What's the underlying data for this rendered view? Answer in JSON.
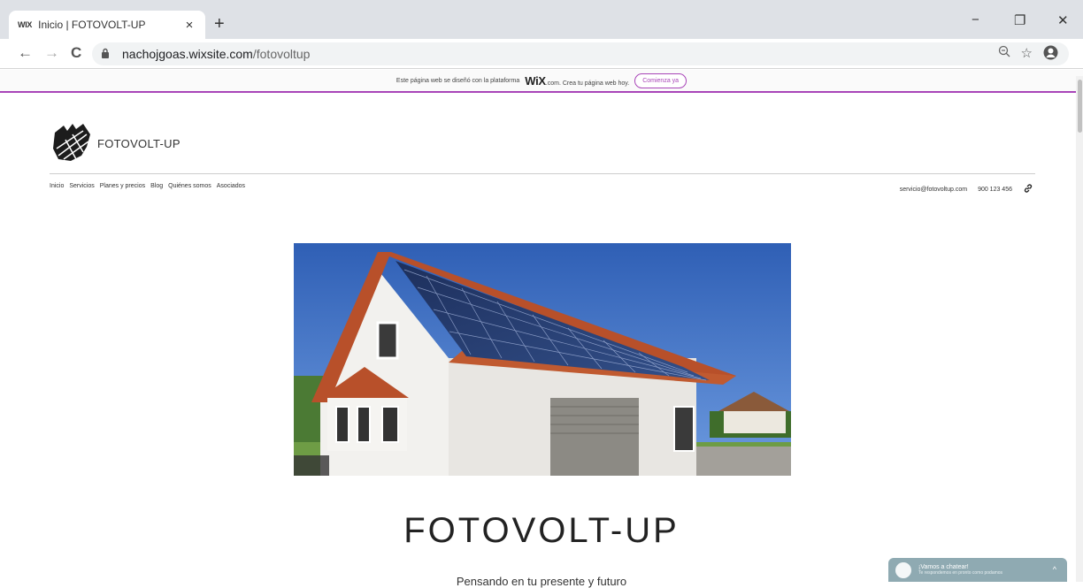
{
  "browser": {
    "tab_favicon": "WIX",
    "tab_title": "Inicio | FOTOVOLT-UP",
    "tab_close": "×",
    "new_tab": "+",
    "url_host": "nachojgoas.wixsite.com",
    "url_path": "/fotovoltup",
    "back": "←",
    "forward": "→",
    "reload": "C",
    "minimize": "−",
    "restore": "❐",
    "close": "✕"
  },
  "wix_banner": {
    "text_before": "Este página web se diseñó con la plataforma",
    "logo": "WiX",
    "text_after": ".com. Crea tu página web hoy.",
    "cta": "Comienza ya"
  },
  "site": {
    "brand_name": "FOTOVOLT-UP",
    "nav": [
      "Inicio",
      "Servicios",
      "Planes y precios",
      "Blog",
      "Quiénes somos",
      "Asociados"
    ],
    "email": "servicio@fotovoltup.com",
    "phone": "900 123 456",
    "hero_title": "FOTOVOLT-UP",
    "hero_subtitle": "Pensando en tu presente y futuro"
  },
  "chat": {
    "title": "¡Vamos a chatear!",
    "subtitle": "Te respondemos en pronto como podamos"
  },
  "colors": {
    "wix_accent": "#a845b8",
    "chat_bg": "#8faab2"
  }
}
